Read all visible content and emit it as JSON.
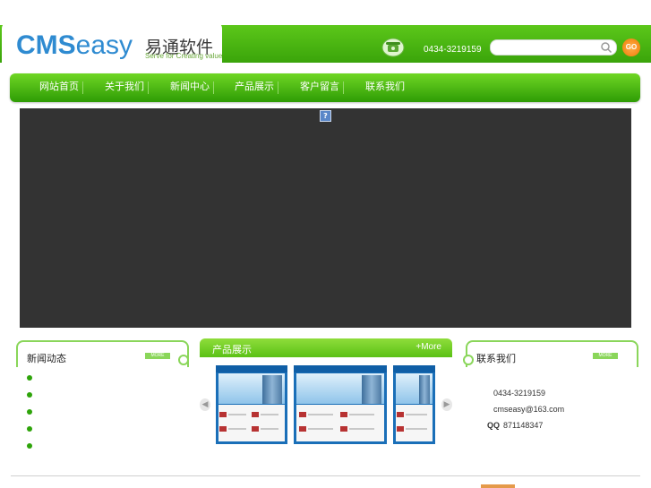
{
  "header": {
    "logo_text_en_1": "CMS",
    "logo_text_en_2": "easy",
    "logo_text_cn": "易通软件",
    "slogan": "Serve for Creating value",
    "phone": "0434-3219159",
    "search_placeholder": "",
    "go_label": "GO"
  },
  "nav": {
    "items": [
      {
        "label": "网站首页"
      },
      {
        "label": "关于我们"
      },
      {
        "label": "新闻中心"
      },
      {
        "label": "产品展示"
      },
      {
        "label": "客户留言"
      },
      {
        "label": "联系我们"
      }
    ]
  },
  "banner": {
    "flash_placeholder": "?"
  },
  "left_panel": {
    "title": "新闻动态",
    "more": "MORE",
    "items": [
      "",
      "",
      "",
      "",
      ""
    ]
  },
  "middle_panel": {
    "title": "产品展示",
    "more": "+More"
  },
  "right_panel": {
    "title": "联系我们",
    "more": "MORE",
    "phone": "0434-3219159",
    "email": "cmseasy@163.com",
    "qq_label": "QQ",
    "qq": "871148347"
  },
  "colors": {
    "brand_green": "#3aa40a",
    "logo_blue": "#2f8bd1",
    "banner_bg": "#333333",
    "go_orange": "#f07a06"
  }
}
